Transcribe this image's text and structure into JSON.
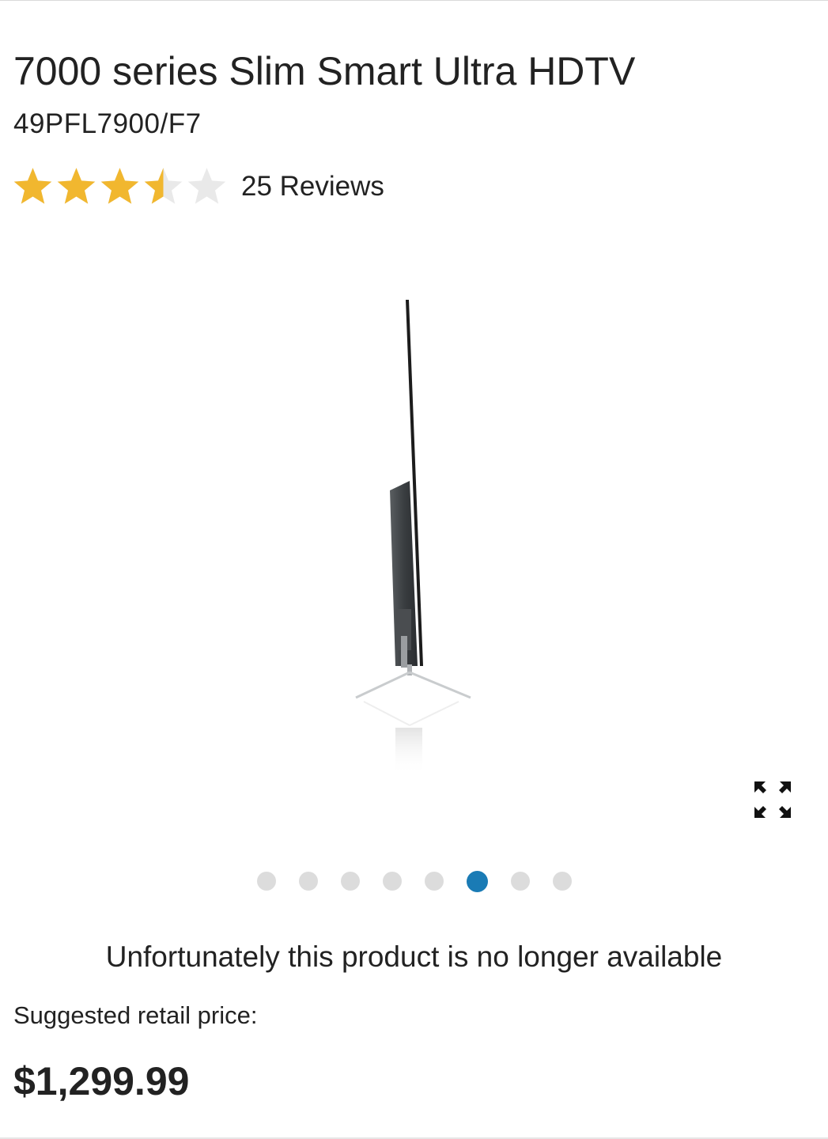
{
  "product": {
    "title": "7000 series Slim Smart Ultra HDTV",
    "model": "49PFL7900/F7"
  },
  "rating": {
    "value": 3.5,
    "max": 5,
    "star_color": "#f1b72f",
    "empty_star_color": "#e9e9e9",
    "reviews_label": "25 Reviews"
  },
  "gallery": {
    "image_icon": "tv-side-view",
    "expand_icon": "expand-arrows-icon",
    "slide_count": 8,
    "active_slide": 6,
    "active_color": "#1a7bb5",
    "inactive_color": "#dcdcdc"
  },
  "availability": {
    "message": "Unfortunately this product is no longer available"
  },
  "pricing": {
    "label": "Suggested retail price:",
    "price": "$1,299.99"
  }
}
